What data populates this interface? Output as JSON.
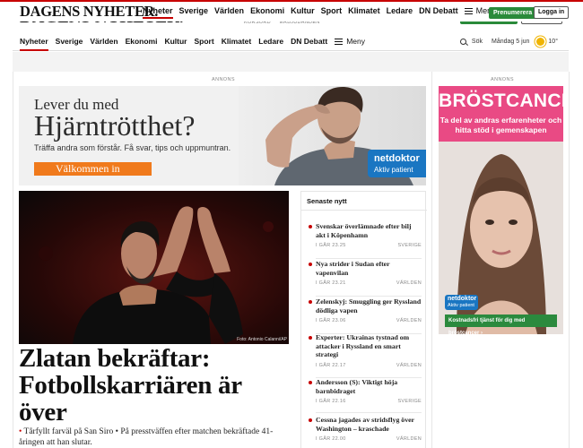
{
  "sticky_header": {
    "logo": "DAGENS NYHETER.",
    "nav": [
      "Nyheter",
      "Sverige",
      "Världen",
      "Ekonomi",
      "Kultur",
      "Sport",
      "Klimatet",
      "Ledare",
      "DN Debatt"
    ],
    "menu_label": "Meny",
    "premium_button": "Prenumerera",
    "login_button": "Logga in"
  },
  "ghost_header": {
    "logo": "DAGENS NYHETER.",
    "sub_left": "KORSORD",
    "sub_right": "ERBJUDANDEN"
  },
  "main_nav": {
    "items": [
      "Nyheter",
      "Sverige",
      "Världen",
      "Ekonomi",
      "Kultur",
      "Sport",
      "Klimatet",
      "Ledare",
      "DN Debatt"
    ],
    "menu_label": "Meny",
    "search_label": "Sök",
    "date": "Måndag 5 jun",
    "temperature": "10°"
  },
  "ads": {
    "label": "ANNONS",
    "ad1": {
      "line1": "Lever du med",
      "line2": "Hjärntrötthet?",
      "line3": "Träffa andra som förstår. Få svar, tips och uppmuntran.",
      "cta": "Välkommen in",
      "brand_a": "netdoktor",
      "brand_b": "Aktiv patient"
    },
    "ad2": {
      "title": "BRÖSTCANCER?",
      "subtitle_1": "Ta del av andras erfarenheter och",
      "subtitle_2": "hitta stöd i gemenskapen",
      "brand_a": "netdoktor",
      "brand_b": "Aktiv patient",
      "cta": "Kostnadsfri tjänst för dig med bröstcancer ›"
    }
  },
  "hero": {
    "photo_credit": "Foto: Antonio Calanni/AP",
    "headline": "Zlatan bekräftar: Fotbollskarriären är över",
    "lede_dot": "•",
    "lede": " Tårfyllt farväl på San Siro • På presstväffen efter matchen bekräftade 41-åringen att han slutar."
  },
  "latest": {
    "heading": "Senaste nytt",
    "items": [
      {
        "title": "Svenskar överlämnade efter bilj akt i Köpenhamn",
        "time": "I GÅR 23.25",
        "section": "SVERIGE"
      },
      {
        "title": "Nya strider i Sudan efter vapenvilan",
        "time": "I GÅR 23.21",
        "section": "VÄRLDEN"
      },
      {
        "title": "Zelenskyj: Smuggling ger Ryssland dödliga vapen",
        "time": "I GÅR 23.06",
        "section": "VÄRLDEN"
      },
      {
        "title": "Experter: Ukrainas tystnad om attacker i Ryssland en smart strategi",
        "time": "I GÅR 22.17",
        "section": "VÄRLDEN"
      },
      {
        "title": "Andersson (S): Viktigt höja barnbidraget",
        "time": "I GÅR 22.16",
        "section": "SVERIGE"
      },
      {
        "title": "Cessna jagades av stridsflyg över Washington – kraschade",
        "time": "I GÅR 22.00",
        "section": "VÄRLDEN"
      }
    ]
  },
  "colors": {
    "brand_red": "#c70000",
    "premium_green": "#2a8a3a",
    "ad_orange": "#f07a1c",
    "ad_pink": "#e94a84",
    "netdoktor_blue": "#1a76c2"
  }
}
